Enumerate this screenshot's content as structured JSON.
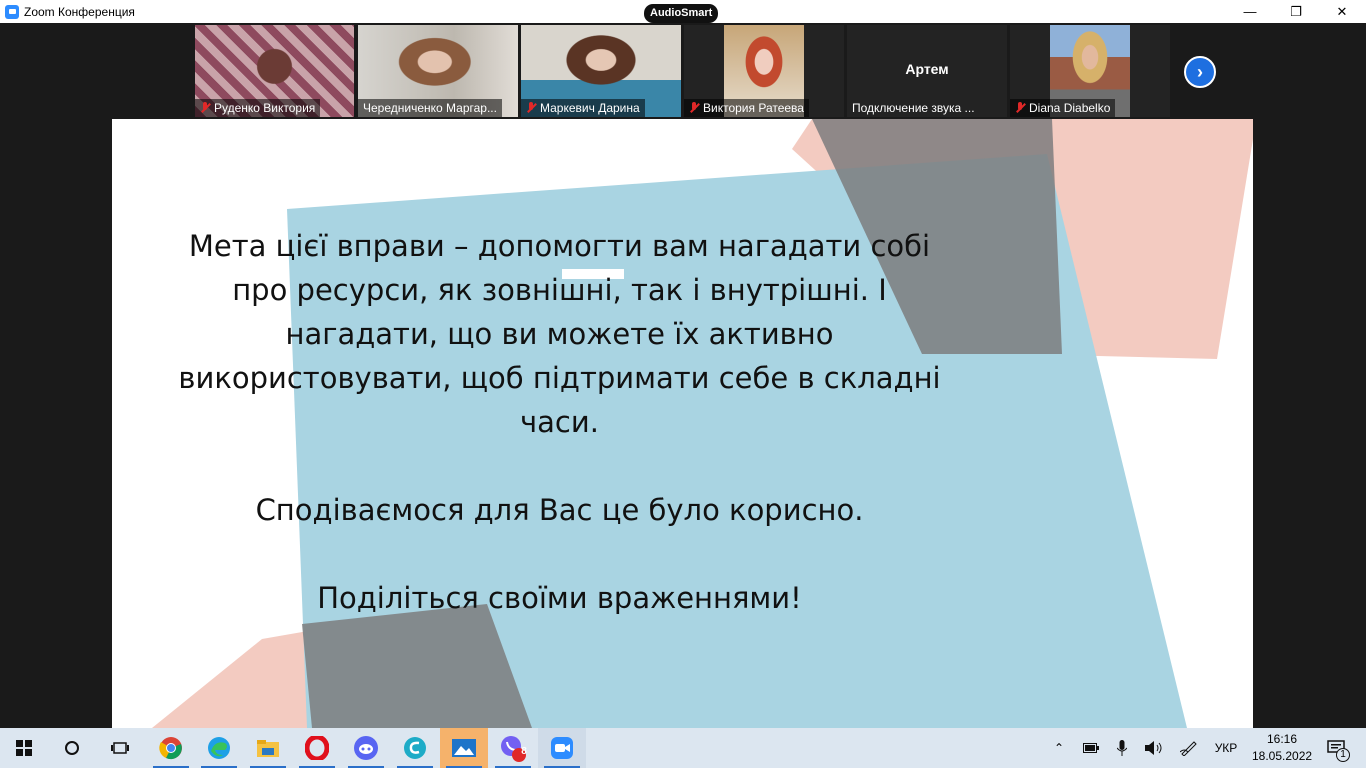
{
  "window": {
    "title": "Zoom Конференция",
    "badge": "AudioSmart",
    "minimize_glyph": "—",
    "restore_glyph": "❐",
    "close_glyph": "✕"
  },
  "participants": [
    {
      "name": "Руденко  Виктория",
      "muted": true
    },
    {
      "name": "Чередниченко Маргар...",
      "muted": false,
      "active": true
    },
    {
      "name": "Маркевич Дарина",
      "muted": true
    },
    {
      "name": "Виктория Ратеева",
      "muted": true
    },
    {
      "name": "Подключение звука ...",
      "center_name": "Артем",
      "muted": false
    },
    {
      "name": "Diana Diabelko",
      "muted": true
    }
  ],
  "next_button_icon": "chevron-right-icon",
  "slide": {
    "paragraphs": [
      "Мета цієї вправи – допомогти вам нагадати собі про ресурси, як зовнішні, так і внутрішні. І нагадати, що ви можете їх активно використовувати, щоб підтримати себе в складні часи.",
      "Сподіваємося для Вас це було корисно.",
      "Поділіться своїми враженнями!"
    ],
    "colors": {
      "blue": "#a9d4e2",
      "pink": "#f3cbc1",
      "gray": "#7c7d7e"
    }
  },
  "taskbar": {
    "apps": [
      "start-icon",
      "search-icon",
      "task-view-icon",
      "chrome-icon",
      "edge-icon",
      "file-explorer-icon",
      "opera-icon",
      "discord-icon",
      "creative-cloud-icon",
      "photos-icon",
      "viber-icon",
      "zoom-icon"
    ],
    "viber_badge": "8",
    "language": "УКР",
    "time": "16:16",
    "date": "18.05.2022",
    "notification_count": "1"
  }
}
